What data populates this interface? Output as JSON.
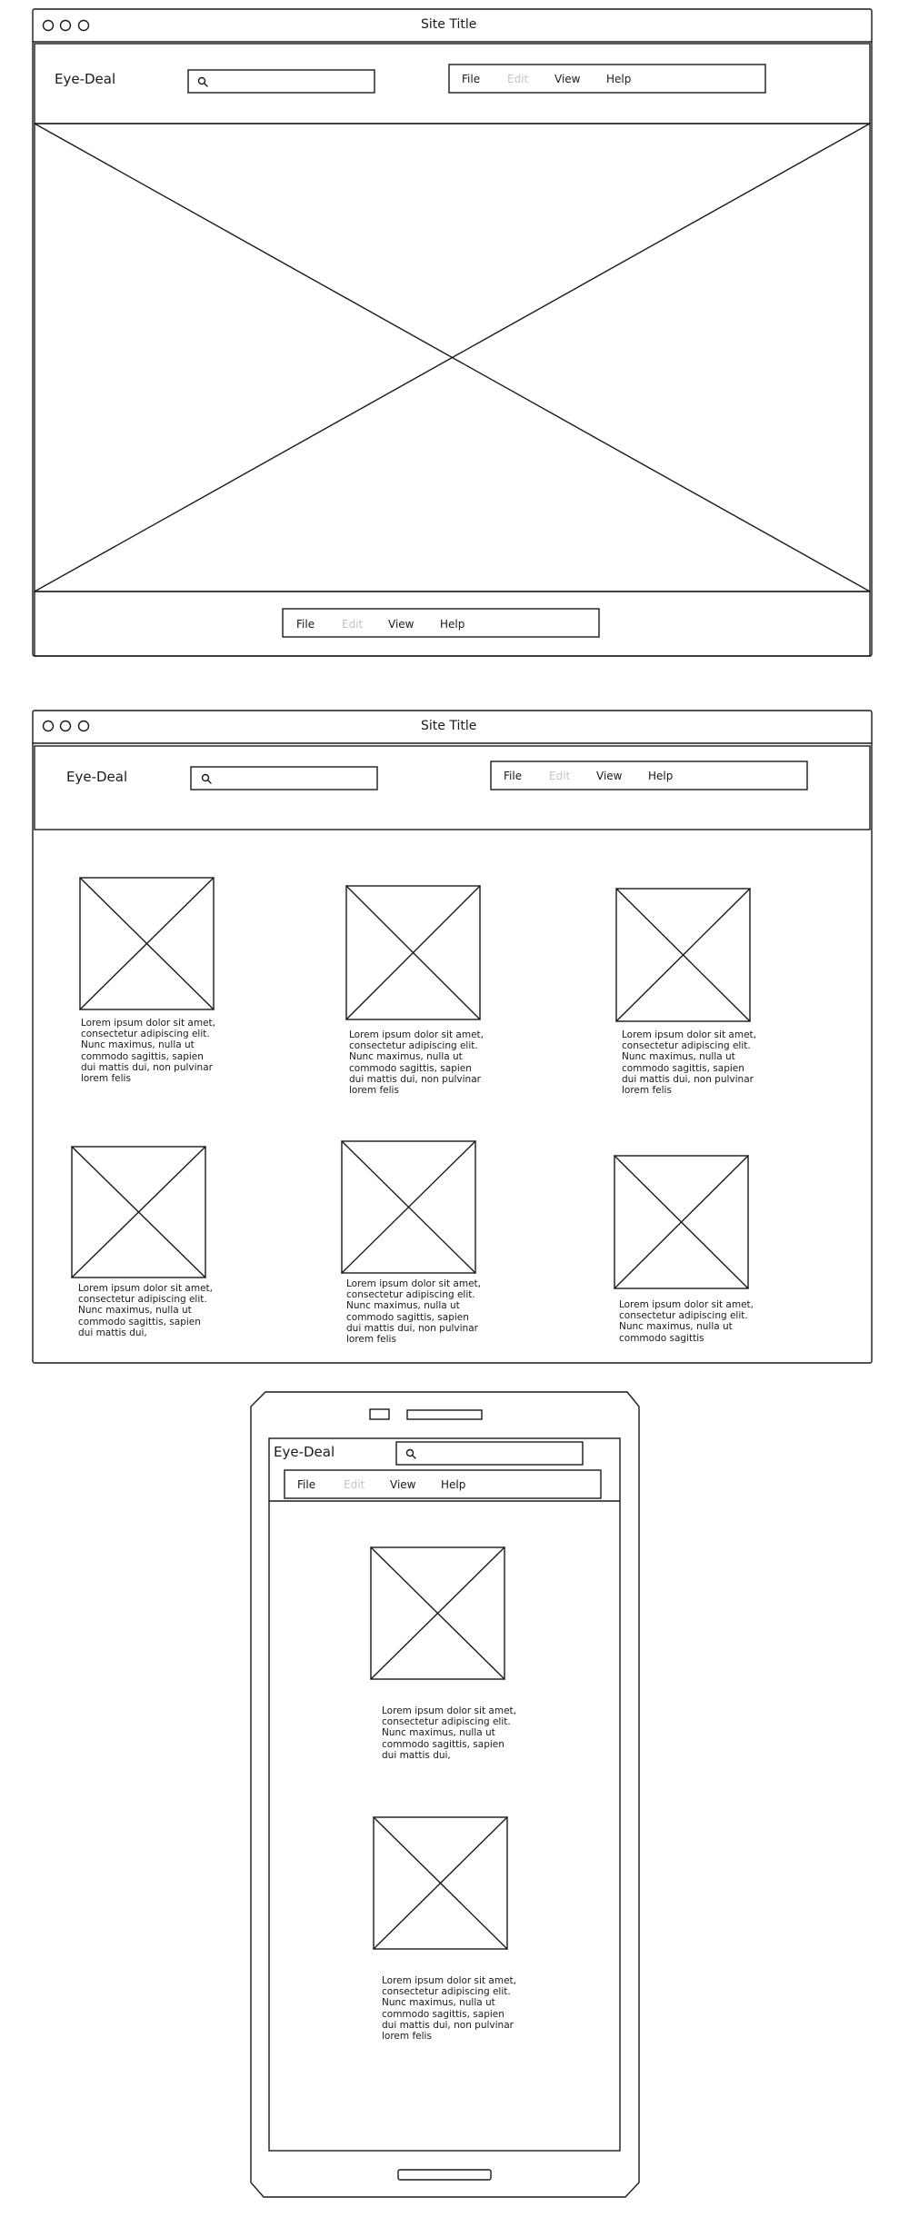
{
  "desktop1": {
    "site_title": "Site Title",
    "logo": "Eye-Deal",
    "menu": [
      "File",
      "Edit",
      "View",
      "Help"
    ],
    "footer_menu": [
      "File",
      "Edit",
      "View",
      "Help"
    ]
  },
  "desktop2": {
    "site_title": "Site Title",
    "logo": "Eye-Deal",
    "menu": [
      "File",
      "Edit",
      "View",
      "Help"
    ],
    "cards": [
      {
        "text": "Lorem ipsum dolor sit amet, consectetur adipiscing elit. Nunc maximus, nulla ut commodo sagittis, sapien dui mattis dui, non pulvinar lorem felis"
      },
      {
        "text": "Lorem ipsum dolor sit amet, consectetur adipiscing elit. Nunc maximus, nulla ut commodo sagittis, sapien dui mattis dui, non pulvinar lorem felis"
      },
      {
        "text": "Lorem ipsum dolor sit amet, consectetur adipiscing elit. Nunc maximus, nulla ut commodo sagittis, sapien dui mattis dui, non pulvinar lorem felis"
      },
      {
        "text": "Lorem ipsum dolor sit amet, consectetur adipiscing elit. Nunc maximus, nulla ut commodo sagittis, sapien dui mattis dui,"
      },
      {
        "text": "Lorem ipsum dolor sit amet, consectetur adipiscing elit. Nunc maximus, nulla ut commodo sagittis, sapien dui mattis dui, non pulvinar lorem felis"
      },
      {
        "text": "Lorem ipsum dolor sit amet, consectetur adipiscing elit. Nunc maximus, nulla ut commodo sagittis"
      }
    ]
  },
  "mobile": {
    "logo": "Eye-Deal",
    "menu": [
      "File",
      "Edit",
      "View",
      "Help"
    ],
    "cards": [
      {
        "text": "Lorem ipsum dolor sit amet, consectetur adipiscing elit. Nunc maximus, nulla ut commodo sagittis, sapien dui mattis dui,"
      },
      {
        "text": "Lorem ipsum dolor sit amet, consectetur adipiscing elit. Nunc maximus, nulla ut commodo sagittis, sapien dui mattis dui, non pulvinar lorem felis"
      }
    ]
  },
  "colors": {
    "ink": "#1a1a1a",
    "disabled": "#c4c4c4",
    "background": "#ffffff"
  },
  "icons": [
    "window-dot-icon",
    "search-icon",
    "placeholder-image-icon"
  ]
}
